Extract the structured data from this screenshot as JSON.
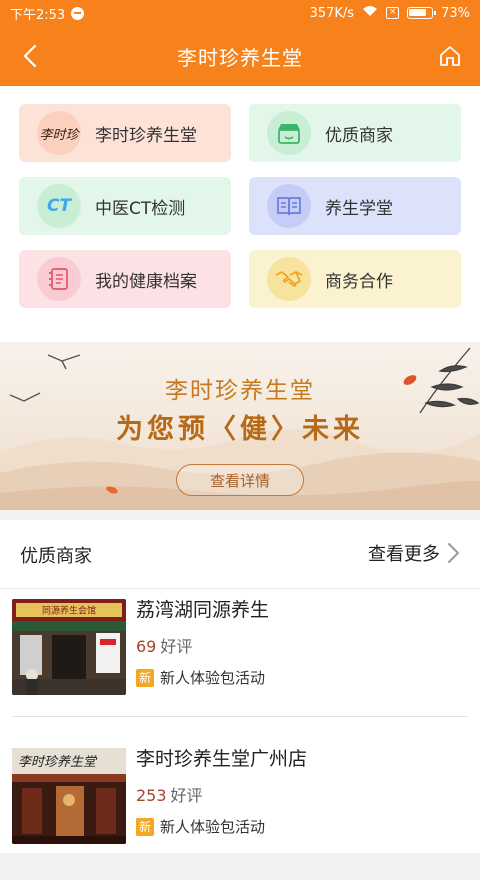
{
  "statusbar": {
    "time": "下午2:53",
    "speed": "357K/s",
    "battery": "73%"
  },
  "header": {
    "title": "李时珍养生堂"
  },
  "tiles": [
    {
      "label": "李时珍养生堂",
      "icon": "brand-logo-icon",
      "logo_text": "李时珍"
    },
    {
      "label": "优质商家",
      "icon": "store-icon"
    },
    {
      "label": "中医CT检测",
      "icon": "ct-icon",
      "icon_text": "CT"
    },
    {
      "label": "养生学堂",
      "icon": "book-icon"
    },
    {
      "label": "我的健康档案",
      "icon": "health-file-icon"
    },
    {
      "label": "商务合作",
      "icon": "handshake-icon"
    }
  ],
  "banner": {
    "title": "李时珍养生堂",
    "subtitle": "为您预〈健〉未来",
    "button": "查看详情"
  },
  "section": {
    "title": "优质商家",
    "more": "查看更多"
  },
  "merchants": [
    {
      "name": "荔湾湖同源养生",
      "rating_count": "69",
      "rating_label": "好评",
      "tag": "新",
      "promo": "新人体验包活动",
      "sign_text": "同源养生会馆"
    },
    {
      "name": "李时珍养生堂广州店",
      "rating_count": "253",
      "rating_label": "好评",
      "tag": "新",
      "promo": "新人体验包活动",
      "sign_text": "李时珍养生堂"
    }
  ],
  "colors": {
    "brand_orange": "#f7821b",
    "rating_red": "#a4452f",
    "tag_orange": "#f5a623"
  }
}
